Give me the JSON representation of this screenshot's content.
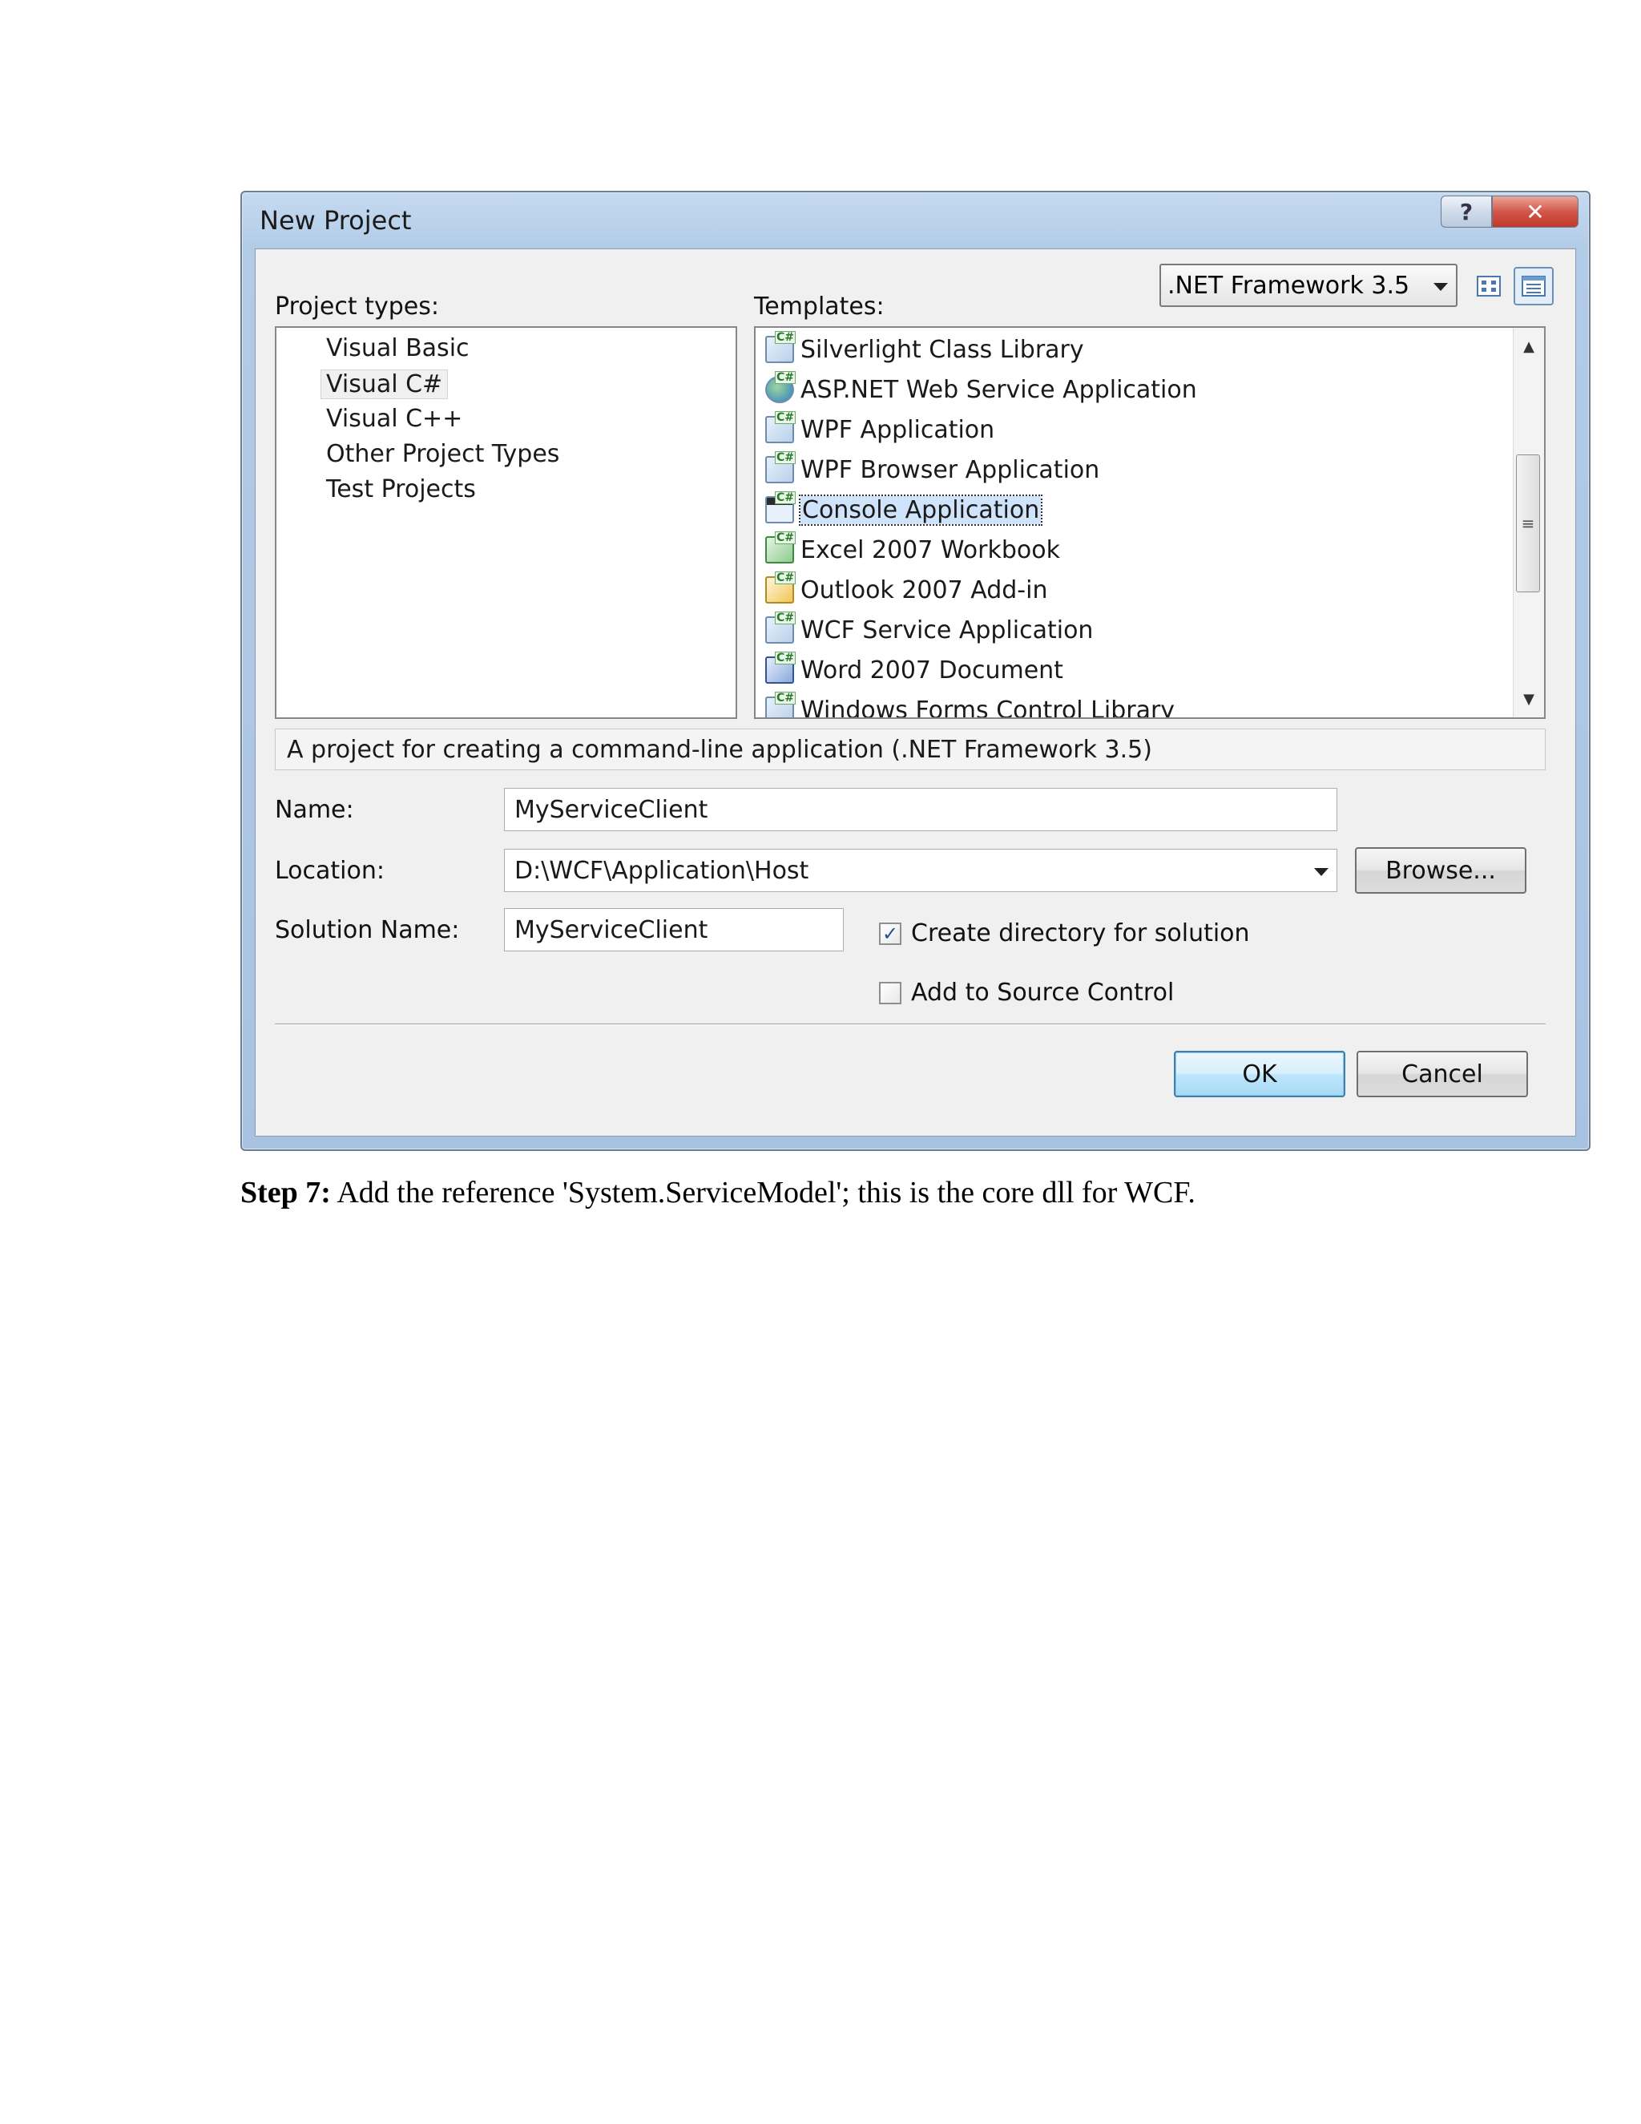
{
  "dialog": {
    "title": "New Project",
    "help_glyph": "?",
    "close_glyph": "✕",
    "project_types_label": "Project types:",
    "templates_label": "Templates:",
    "project_types": [
      "Visual Basic",
      "Visual C#",
      "Visual C++",
      "Other Project Types",
      "Test Projects"
    ],
    "selected_project_type": "Visual C#",
    "framework": ".NET Framework 3.5",
    "templates": [
      "Silverlight Class Library",
      "ASP.NET Web Service Application",
      "WPF Application",
      "WPF Browser Application",
      "Console Application",
      "Excel 2007 Workbook",
      "Outlook 2007 Add-in",
      "WCF Service Application",
      "Word 2007 Document",
      "Windows Forms Control Library"
    ],
    "selected_template": "Console Application",
    "description": "A project for creating a command-line application (.NET Framework 3.5)",
    "name_label": "Name:",
    "name_value": "MyServiceClient",
    "location_label": "Location:",
    "location_value": "D:\\WCF\\Application\\Host",
    "browse_label": "Browse...",
    "solution_name_label": "Solution Name:",
    "solution_name_value": "MyServiceClient",
    "create_directory_label": "Create directory for solution",
    "create_directory_checked": true,
    "add_source_control_label": "Add to Source Control",
    "add_source_control_checked": false,
    "ok_label": "OK",
    "cancel_label": "Cancel"
  },
  "step": {
    "label": "Step 7:",
    "text": " Add the reference 'System.ServiceModel'; this is the core dll for WCF."
  },
  "colors": {
    "title_bar": "#b2cbe6",
    "close_button": "#c2392b",
    "selection": "#cfe3fa"
  }
}
